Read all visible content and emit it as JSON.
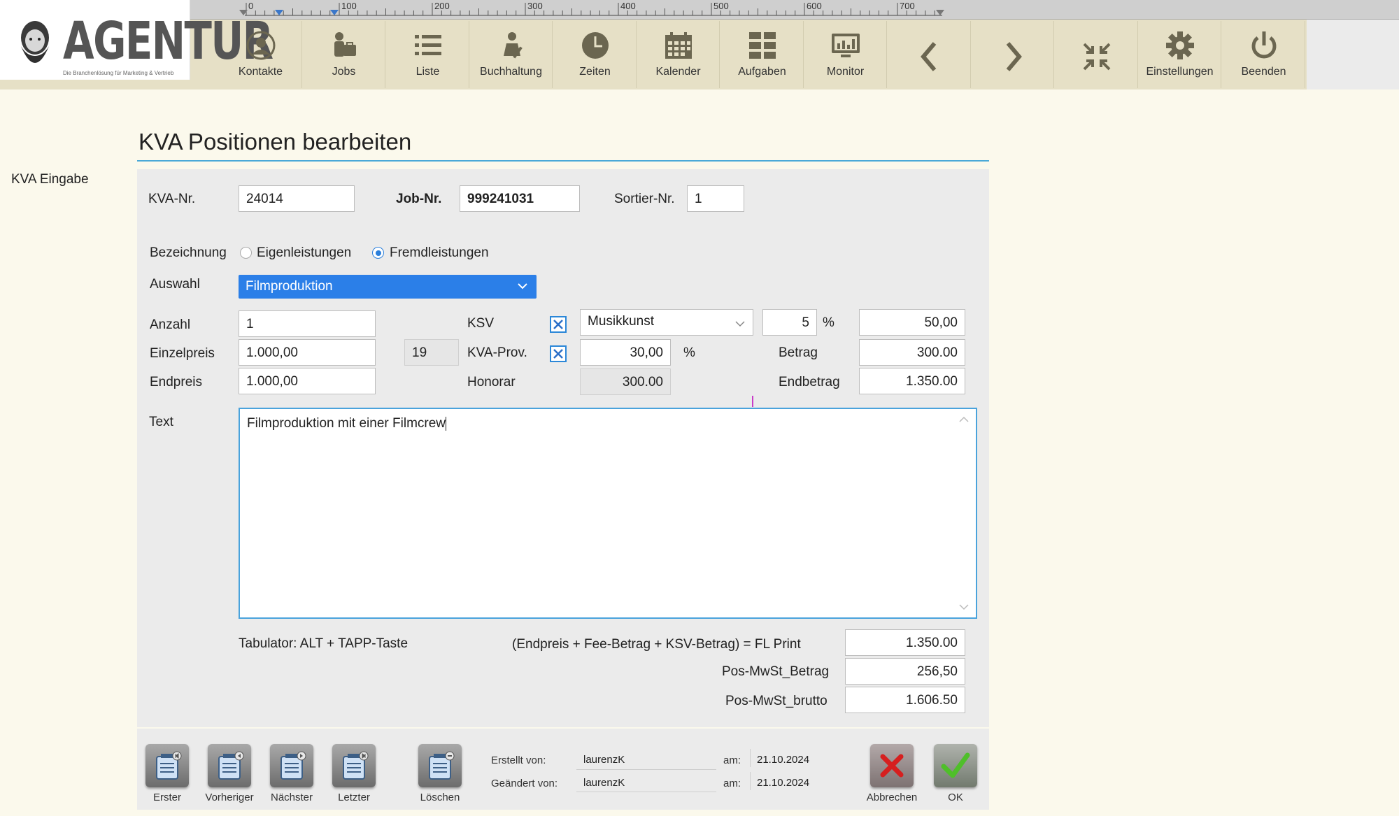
{
  "logo": {
    "title": "AGENTUR",
    "subtitle": "Die Branchenlösung für Marketing & Vertrieb"
  },
  "ruler": {
    "ticks": [
      "0",
      "100",
      "200",
      "300",
      "400",
      "500",
      "600",
      "700"
    ]
  },
  "toolbar": {
    "buttons": [
      {
        "label": "Kontakte",
        "icon": "contact-icon"
      },
      {
        "label": "Jobs",
        "icon": "jobs-icon"
      },
      {
        "label": "Liste",
        "icon": "list-icon"
      },
      {
        "label": "Buchhaltung",
        "icon": "accounting-icon"
      },
      {
        "label": "Zeiten",
        "icon": "clock-icon"
      },
      {
        "label": "Kalender",
        "icon": "calendar-icon"
      },
      {
        "label": "Aufgaben",
        "icon": "tasks-icon"
      },
      {
        "label": "Monitor",
        "icon": "monitor-icon"
      },
      {
        "label": "",
        "icon": "chevron-left-icon"
      },
      {
        "label": "",
        "icon": "chevron-right-icon"
      },
      {
        "label": "",
        "icon": "collapse-icon"
      },
      {
        "label": "Einstellungen",
        "icon": "gear-icon"
      },
      {
        "label": "Beenden",
        "icon": "power-icon"
      }
    ]
  },
  "sidebar": {
    "label": "KVA Eingabe"
  },
  "page": {
    "title": "KVA Positionen bearbeiten"
  },
  "form": {
    "kva_nr": {
      "label": "KVA-Nr.",
      "value": "24014"
    },
    "job_nr": {
      "label": "Job-Nr.",
      "value": "999241031"
    },
    "sort_nr": {
      "label": "Sortier-Nr.",
      "value": "1"
    },
    "bezeichnung": {
      "label": "Bezeichnung",
      "options": [
        "Eigenleistungen",
        "Fremdleistungen"
      ],
      "selected": "Fremdleistungen"
    },
    "auswahl": {
      "label": "Auswahl",
      "value": "Filmproduktion"
    },
    "anzahl": {
      "label": "Anzahl",
      "value": "1"
    },
    "einzelpreis": {
      "label": "Einzelpreis",
      "value": "1.000,00",
      "tax": "19"
    },
    "endpreis": {
      "label": "Endpreis",
      "value": "1.000,00"
    },
    "ksv": {
      "label": "KSV",
      "checked": true,
      "category": "Musikkunst",
      "percent": "5",
      "percent_sign": "%",
      "amount": "50,00"
    },
    "kva_prov": {
      "label": "KVA-Prov.",
      "checked": true,
      "percent": "30,00",
      "percent_sign": "%"
    },
    "honorar": {
      "label": "Honorar",
      "value": "300.00"
    },
    "betrag": {
      "label": "Betrag",
      "value": "300.00"
    },
    "endbetrag": {
      "label": "Endbetrag",
      "value": "1.350.00"
    },
    "text": {
      "label": "Text",
      "value": "Filmproduktion mit einer Filmcrew"
    },
    "hint": "Tabulator: ALT + TAPP-Taste",
    "fl_print": {
      "label": "(Endpreis + Fee-Betrag + KSV-Betrag) = FL Print",
      "value": "1.350.00"
    },
    "pos_mwst_betrag": {
      "label": "Pos-MwSt_Betrag",
      "value": "256,50"
    },
    "pos_mwst_brutto": {
      "label": "Pos-MwSt_brutto",
      "value": "1.606.50"
    }
  },
  "footer": {
    "nav": [
      "Erster",
      "Vorheriger",
      "Nächster",
      "Letzter"
    ],
    "delete": "Löschen",
    "created_label": "Erstellt von:",
    "created_by": "laurenzK",
    "changed_label": "Geändert von:",
    "changed_by": "laurenzK",
    "am_label": "am:",
    "created_date": "21.10.2024",
    "changed_date": "21.10.2024",
    "cancel": "Abbrechen",
    "ok": "OK"
  }
}
